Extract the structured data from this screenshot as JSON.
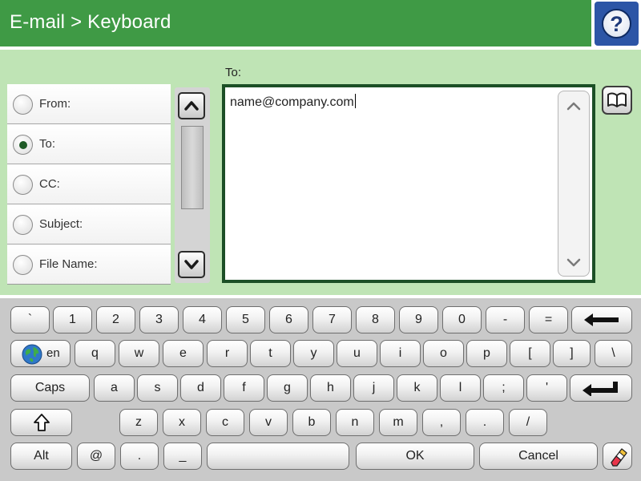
{
  "header": {
    "title": "E-mail > Keyboard",
    "help_label": "?"
  },
  "composer": {
    "to_label": "To:",
    "to_value": "name@company.com",
    "fields": [
      {
        "label": "From:",
        "selected": false
      },
      {
        "label": "To:",
        "selected": true
      },
      {
        "label": "CC:",
        "selected": false
      },
      {
        "label": "Subject:",
        "selected": false
      },
      {
        "label": "File Name:",
        "selected": false
      }
    ]
  },
  "keyboard": {
    "row1": [
      "`",
      "1",
      "2",
      "3",
      "4",
      "5",
      "6",
      "7",
      "8",
      "9",
      "0",
      "-",
      "="
    ],
    "row2": [
      "q",
      "w",
      "e",
      "r",
      "t",
      "y",
      "u",
      "i",
      "o",
      "p",
      "[",
      "]",
      "\\"
    ],
    "row3": [
      "a",
      "s",
      "d",
      "f",
      "g",
      "h",
      "j",
      "k",
      "l",
      ";",
      "'"
    ],
    "row4": [
      "z",
      "x",
      "c",
      "v",
      "b",
      "n",
      "m",
      ",",
      ".",
      "/"
    ],
    "language_label": "en",
    "caps_label": "Caps",
    "alt_label": "Alt",
    "at_label": "@",
    "dot_label": ".",
    "underscore_label": "_",
    "ok_label": "OK",
    "cancel_label": "Cancel",
    "backspace_icon": "backspace-arrow-icon",
    "enter_icon": "enter-arrow-icon",
    "shift_icon": "shift-arrow-icon",
    "clear_icon": "eraser-icon",
    "language_icon": "globe-icon"
  },
  "colors": {
    "header_green": "#3f9a45",
    "panel_green": "#bfe4b5",
    "field_frame": "#1c4f26",
    "help_blue": "#2c55a6"
  }
}
